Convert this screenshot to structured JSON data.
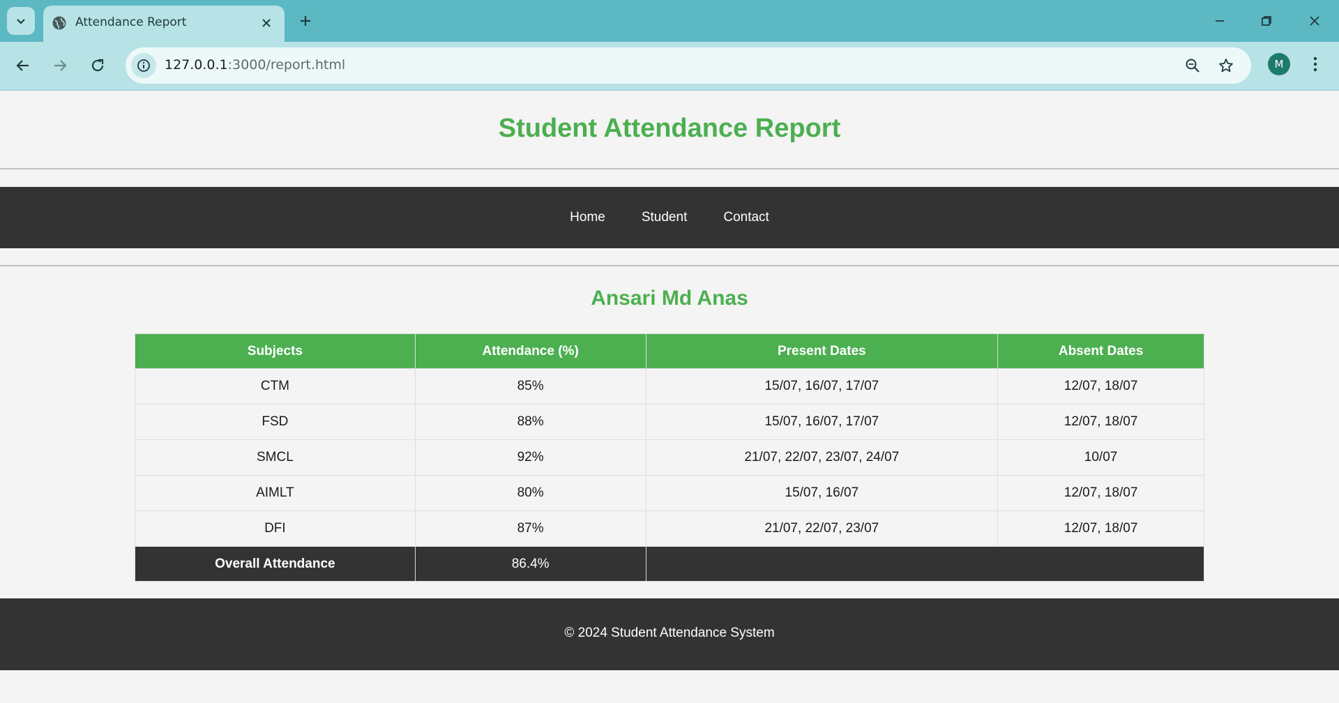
{
  "browser": {
    "tab_title": "Attendance Report",
    "url_host": "127.0.0.1",
    "url_path": ":3000/report.html",
    "profile_initial": "M"
  },
  "page": {
    "title": "Student Attendance Report",
    "nav": [
      "Home",
      "Student",
      "Contact"
    ],
    "student_name": "Ansari Md Anas",
    "table": {
      "headers": [
        "Subjects",
        "Attendance (%)",
        "Present Dates",
        "Absent Dates"
      ],
      "rows": [
        [
          "CTM",
          "85%",
          "15/07, 16/07, 17/07",
          "12/07, 18/07"
        ],
        [
          "FSD",
          "88%",
          "15/07, 16/07, 17/07",
          "12/07, 18/07"
        ],
        [
          "SMCL",
          "92%",
          "21/07, 22/07, 23/07, 24/07",
          "10/07"
        ],
        [
          "AIMLT",
          "80%",
          "15/07, 16/07",
          "12/07, 18/07"
        ],
        [
          "DFI",
          "87%",
          "21/07, 22/07, 23/07",
          "12/07, 18/07"
        ]
      ],
      "overall_label": "Overall Attendance",
      "overall_value": "86.4%"
    },
    "footer": "© 2024 Student Attendance System"
  },
  "colors": {
    "accent": "#4caf50",
    "dark": "#333333",
    "chrome": "#5cb8c2"
  },
  "icons": {
    "tab_search": "chevron-down-icon",
    "favicon": "globe-icon",
    "close": "close-icon",
    "new_tab": "plus-icon",
    "back": "arrow-left-icon",
    "forward": "arrow-right-icon",
    "reload": "reload-icon",
    "site_info": "info-icon",
    "zoom": "zoom-out-icon",
    "bookmark": "star-icon",
    "menu": "kebab-menu-icon"
  }
}
